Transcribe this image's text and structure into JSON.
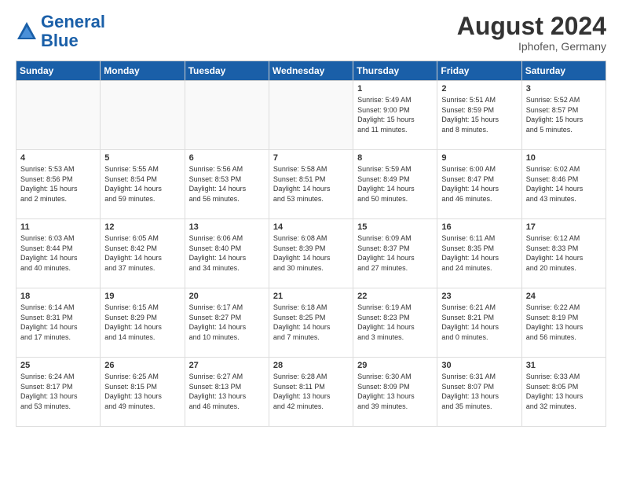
{
  "header": {
    "logo_general": "General",
    "logo_blue": "Blue",
    "month_year": "August 2024",
    "location": "Iphofen, Germany"
  },
  "weekdays": [
    "Sunday",
    "Monday",
    "Tuesday",
    "Wednesday",
    "Thursday",
    "Friday",
    "Saturday"
  ],
  "weeks": [
    [
      {
        "day": "",
        "info": "",
        "empty": true
      },
      {
        "day": "",
        "info": "",
        "empty": true
      },
      {
        "day": "",
        "info": "",
        "empty": true
      },
      {
        "day": "",
        "info": "",
        "empty": true
      },
      {
        "day": "1",
        "info": "Sunrise: 5:49 AM\nSunset: 9:00 PM\nDaylight: 15 hours\nand 11 minutes."
      },
      {
        "day": "2",
        "info": "Sunrise: 5:51 AM\nSunset: 8:59 PM\nDaylight: 15 hours\nand 8 minutes."
      },
      {
        "day": "3",
        "info": "Sunrise: 5:52 AM\nSunset: 8:57 PM\nDaylight: 15 hours\nand 5 minutes."
      }
    ],
    [
      {
        "day": "4",
        "info": "Sunrise: 5:53 AM\nSunset: 8:56 PM\nDaylight: 15 hours\nand 2 minutes."
      },
      {
        "day": "5",
        "info": "Sunrise: 5:55 AM\nSunset: 8:54 PM\nDaylight: 14 hours\nand 59 minutes."
      },
      {
        "day": "6",
        "info": "Sunrise: 5:56 AM\nSunset: 8:53 PM\nDaylight: 14 hours\nand 56 minutes."
      },
      {
        "day": "7",
        "info": "Sunrise: 5:58 AM\nSunset: 8:51 PM\nDaylight: 14 hours\nand 53 minutes."
      },
      {
        "day": "8",
        "info": "Sunrise: 5:59 AM\nSunset: 8:49 PM\nDaylight: 14 hours\nand 50 minutes."
      },
      {
        "day": "9",
        "info": "Sunrise: 6:00 AM\nSunset: 8:47 PM\nDaylight: 14 hours\nand 46 minutes."
      },
      {
        "day": "10",
        "info": "Sunrise: 6:02 AM\nSunset: 8:46 PM\nDaylight: 14 hours\nand 43 minutes."
      }
    ],
    [
      {
        "day": "11",
        "info": "Sunrise: 6:03 AM\nSunset: 8:44 PM\nDaylight: 14 hours\nand 40 minutes."
      },
      {
        "day": "12",
        "info": "Sunrise: 6:05 AM\nSunset: 8:42 PM\nDaylight: 14 hours\nand 37 minutes."
      },
      {
        "day": "13",
        "info": "Sunrise: 6:06 AM\nSunset: 8:40 PM\nDaylight: 14 hours\nand 34 minutes."
      },
      {
        "day": "14",
        "info": "Sunrise: 6:08 AM\nSunset: 8:39 PM\nDaylight: 14 hours\nand 30 minutes."
      },
      {
        "day": "15",
        "info": "Sunrise: 6:09 AM\nSunset: 8:37 PM\nDaylight: 14 hours\nand 27 minutes."
      },
      {
        "day": "16",
        "info": "Sunrise: 6:11 AM\nSunset: 8:35 PM\nDaylight: 14 hours\nand 24 minutes."
      },
      {
        "day": "17",
        "info": "Sunrise: 6:12 AM\nSunset: 8:33 PM\nDaylight: 14 hours\nand 20 minutes."
      }
    ],
    [
      {
        "day": "18",
        "info": "Sunrise: 6:14 AM\nSunset: 8:31 PM\nDaylight: 14 hours\nand 17 minutes."
      },
      {
        "day": "19",
        "info": "Sunrise: 6:15 AM\nSunset: 8:29 PM\nDaylight: 14 hours\nand 14 minutes."
      },
      {
        "day": "20",
        "info": "Sunrise: 6:17 AM\nSunset: 8:27 PM\nDaylight: 14 hours\nand 10 minutes."
      },
      {
        "day": "21",
        "info": "Sunrise: 6:18 AM\nSunset: 8:25 PM\nDaylight: 14 hours\nand 7 minutes."
      },
      {
        "day": "22",
        "info": "Sunrise: 6:19 AM\nSunset: 8:23 PM\nDaylight: 14 hours\nand 3 minutes."
      },
      {
        "day": "23",
        "info": "Sunrise: 6:21 AM\nSunset: 8:21 PM\nDaylight: 14 hours\nand 0 minutes."
      },
      {
        "day": "24",
        "info": "Sunrise: 6:22 AM\nSunset: 8:19 PM\nDaylight: 13 hours\nand 56 minutes."
      }
    ],
    [
      {
        "day": "25",
        "info": "Sunrise: 6:24 AM\nSunset: 8:17 PM\nDaylight: 13 hours\nand 53 minutes."
      },
      {
        "day": "26",
        "info": "Sunrise: 6:25 AM\nSunset: 8:15 PM\nDaylight: 13 hours\nand 49 minutes."
      },
      {
        "day": "27",
        "info": "Sunrise: 6:27 AM\nSunset: 8:13 PM\nDaylight: 13 hours\nand 46 minutes."
      },
      {
        "day": "28",
        "info": "Sunrise: 6:28 AM\nSunset: 8:11 PM\nDaylight: 13 hours\nand 42 minutes."
      },
      {
        "day": "29",
        "info": "Sunrise: 6:30 AM\nSunset: 8:09 PM\nDaylight: 13 hours\nand 39 minutes."
      },
      {
        "day": "30",
        "info": "Sunrise: 6:31 AM\nSunset: 8:07 PM\nDaylight: 13 hours\nand 35 minutes."
      },
      {
        "day": "31",
        "info": "Sunrise: 6:33 AM\nSunset: 8:05 PM\nDaylight: 13 hours\nand 32 minutes."
      }
    ]
  ]
}
